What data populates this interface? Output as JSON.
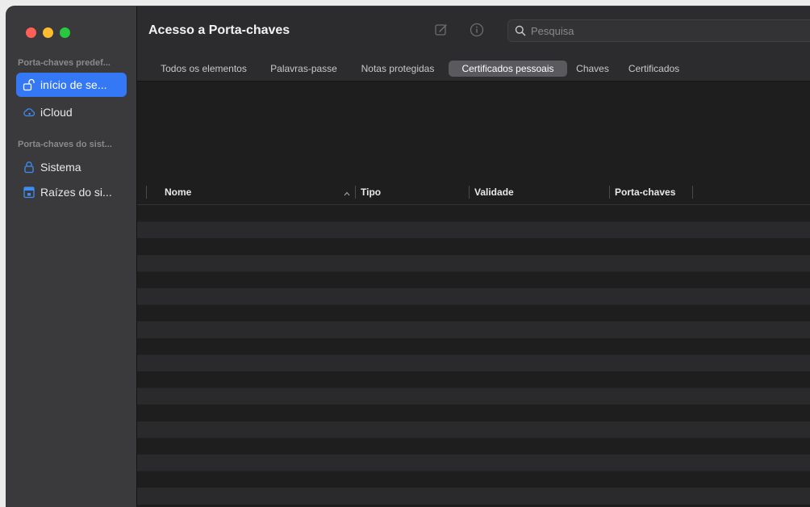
{
  "window": {
    "title": "Acesso a Porta-chaves"
  },
  "traffic_lights": {
    "close_color": "#ff5f57",
    "minimize_color": "#febc2e",
    "zoom_color": "#28c840"
  },
  "toolbar": {
    "search_placeholder": "Pesquisa",
    "icons": [
      "compose-icon",
      "info-icon",
      "search-icon"
    ]
  },
  "sidebar": {
    "sections": [
      {
        "header": "Porta-chaves predef...",
        "items": [
          {
            "label": "início de se...",
            "icon": "unlocked-padlock-icon",
            "selected": true
          },
          {
            "label": "iCloud",
            "icon": "cloud-icon",
            "selected": false
          }
        ]
      },
      {
        "header": "Porta-chaves do sist...",
        "items": [
          {
            "label": "Sistema",
            "icon": "padlock-icon",
            "selected": false
          },
          {
            "label": "Raízes do si...",
            "icon": "cabinet-icon",
            "selected": false
          }
        ]
      }
    ]
  },
  "tabs": [
    {
      "label": "Todos os elementos",
      "active": false
    },
    {
      "label": "Palavras-passe",
      "active": false
    },
    {
      "label": "Notas protegidas",
      "active": false
    },
    {
      "label": "Certificados pessoais",
      "active": true
    },
    {
      "label": "Chaves",
      "active": false
    },
    {
      "label": "Certificados",
      "active": false
    }
  ],
  "table": {
    "columns": [
      "Nome",
      "Tipo",
      "Validade",
      "Porta-chaves"
    ],
    "sort_column": "Nome",
    "sort_direction": "ascending",
    "rows": []
  },
  "colors": {
    "accent": "#3478f6",
    "sidebar_bg": "#3a3a3c",
    "content_bg": "#1e1e1e",
    "alt_row_bg": "#2a2a2c"
  }
}
